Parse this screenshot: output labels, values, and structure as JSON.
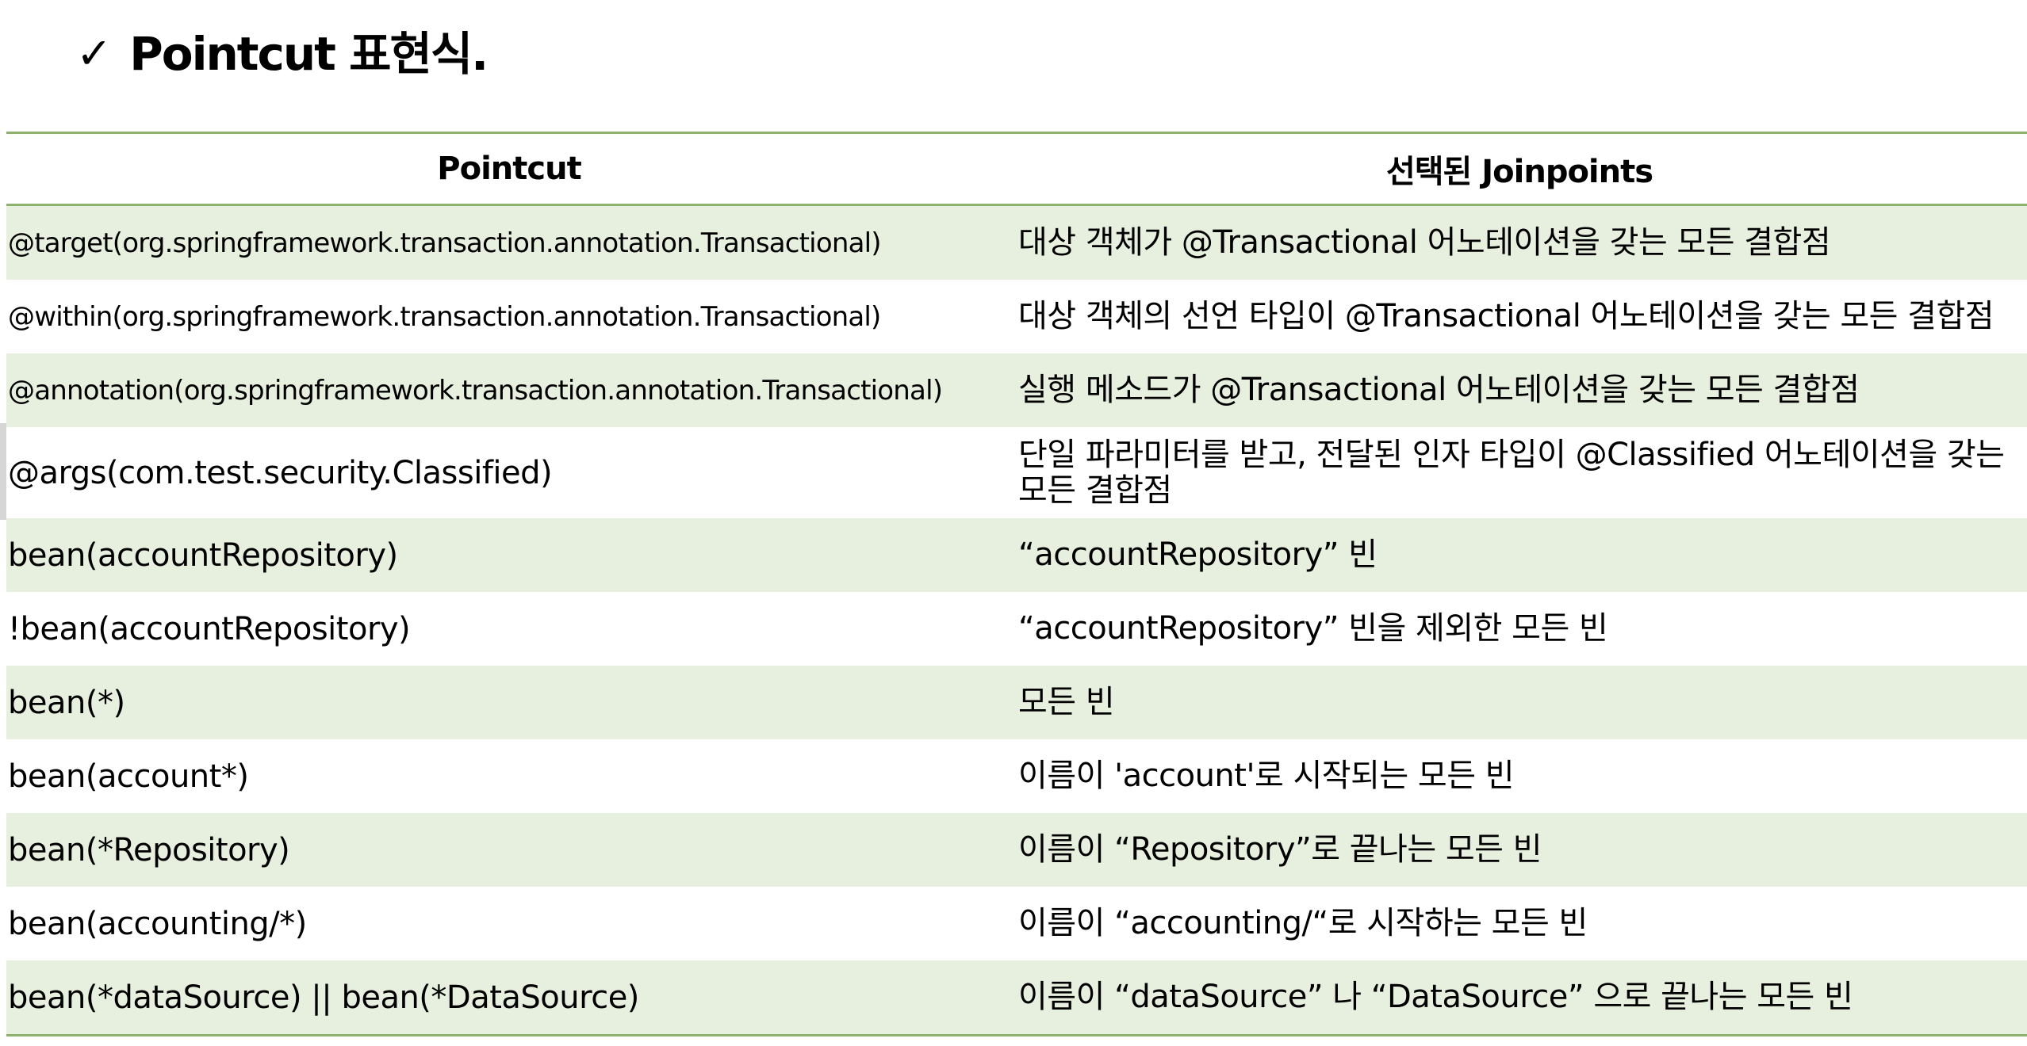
{
  "slide": {
    "check_glyph": "✓",
    "title": "Pointcut 표현식."
  },
  "table": {
    "headers": [
      "Pointcut",
      "선택된 Joinpoints"
    ],
    "rows": [
      {
        "pointcut": "@target(org.springframework.transaction.annotation.Transactional)",
        "joinpoints": "대상 객체가 @Transactional 어노테이션을 갖는 모든 결합점"
      },
      {
        "pointcut": "@within(org.springframework.transaction.annotation.Transactional)",
        "joinpoints": "대상 객체의 선언 타입이 @Transactional 어노테이션을 갖는 모든 결합점"
      },
      {
        "pointcut": "@annotation(org.springframework.transaction.annotation.Transactional)",
        "joinpoints": "실행 메소드가 @Transactional 어노테이션을 갖는 모든 결합점"
      },
      {
        "pointcut": "@args(com.test.security.Classified)",
        "joinpoints": "단일 파라미터를 받고, 전달된 인자 타입이 @Classified 어노테이션을 갖는 모든 결합점"
      },
      {
        "pointcut": "bean(accountRepository)",
        "joinpoints": "“accountRepository” 빈"
      },
      {
        "pointcut": "!bean(accountRepository)",
        "joinpoints": "“accountRepository” 빈을 제외한 모든 빈"
      },
      {
        "pointcut": "bean(*)",
        "joinpoints": "모든 빈"
      },
      {
        "pointcut": "bean(account*)",
        "joinpoints": "이름이 'account'로 시작되는 모든 빈"
      },
      {
        "pointcut": "bean(*Repository)",
        "joinpoints": "이름이 “Repository”로 끝나는 모든 빈"
      },
      {
        "pointcut": "bean(accounting/*)",
        "joinpoints": "이름이 “accounting/“로 시작하는 모든 빈"
      },
      {
        "pointcut": "bean(*dataSource) || bean(*DataSource)",
        "joinpoints": "이름이 “dataSource” 나 “DataSource” 으로 끝나는 모든 빈"
      }
    ]
  },
  "colors": {
    "row_band": "#e7f0df",
    "rule_line": "#8cb36e",
    "text": "#000000"
  }
}
